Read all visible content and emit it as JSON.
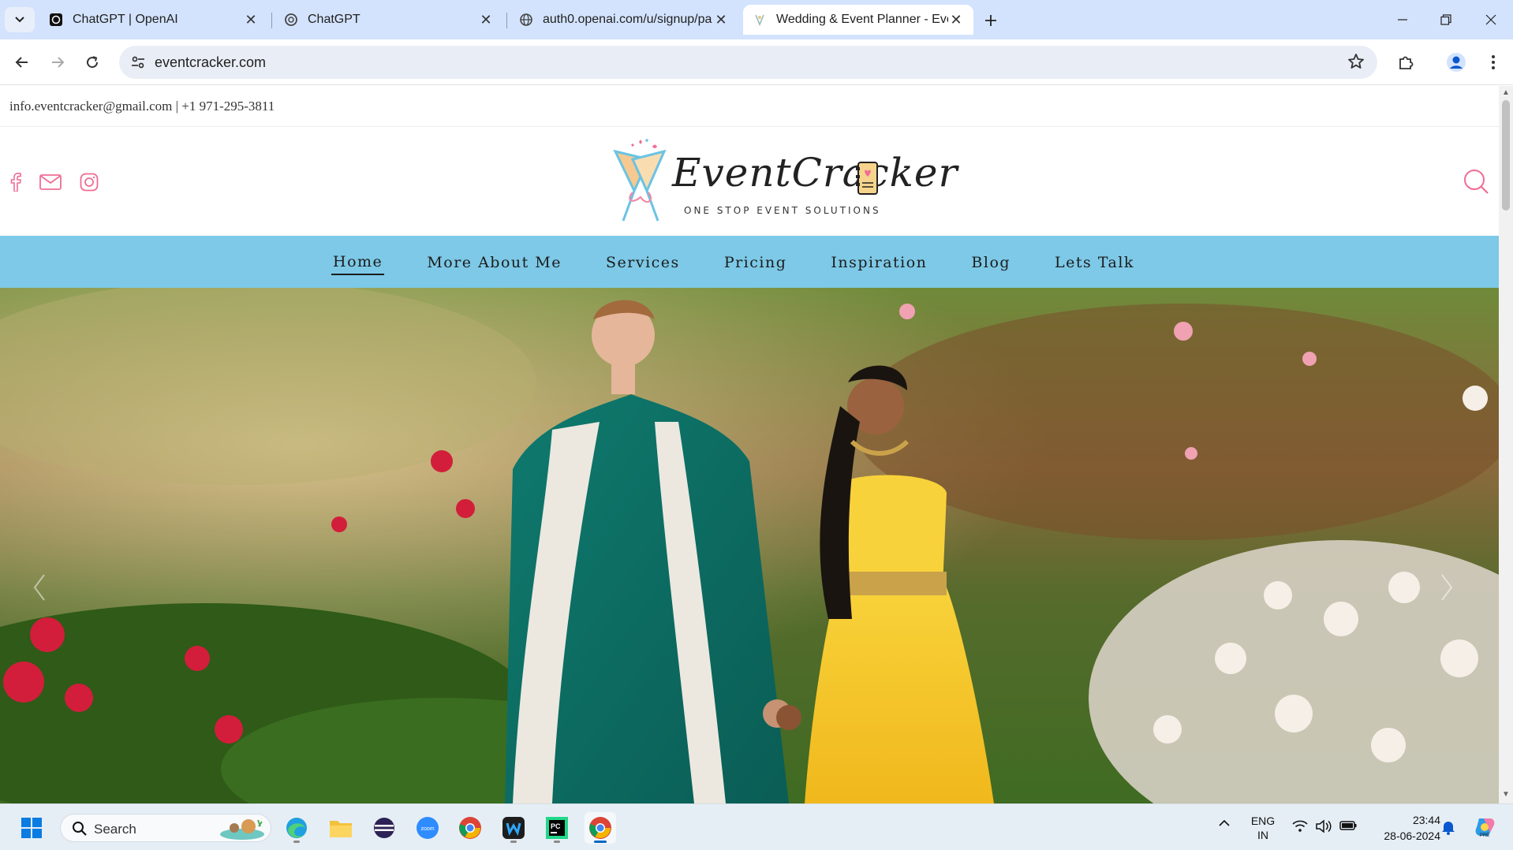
{
  "browser": {
    "tabs": [
      {
        "title": "ChatGPT | OpenAI",
        "icon": "openai-icon",
        "active": false
      },
      {
        "title": "ChatGPT",
        "icon": "openai-icon",
        "active": false
      },
      {
        "title": "auth0.openai.com/u/signup/pa",
        "icon": "globe-icon",
        "active": false
      },
      {
        "title": "Wedding & Event Planner - Eve",
        "icon": "eventcracker-favicon",
        "active": true
      }
    ],
    "address": "eventcracker.com"
  },
  "site": {
    "contact": "info.eventcracker@gmail.com | +1 971-295-3811",
    "logo": {
      "script": "EventCracker",
      "tagline": "ONE STOP EVENT SOLUTIONS"
    },
    "social": [
      "facebook-icon",
      "mail-icon",
      "instagram-icon"
    ],
    "nav": [
      {
        "label": "Home",
        "active": true
      },
      {
        "label": "More About Me",
        "active": false
      },
      {
        "label": "Services",
        "active": false
      },
      {
        "label": "Pricing",
        "active": false
      },
      {
        "label": "Inspiration",
        "active": false
      },
      {
        "label": "Blog",
        "active": false
      },
      {
        "label": "Lets Talk",
        "active": false
      }
    ],
    "colors": {
      "nav_bg": "#7dc9e7",
      "accent_pink": "#f06d95"
    }
  },
  "taskbar": {
    "search_label": "Search",
    "apps": [
      "windows-start-icon",
      "edge-icon",
      "file-explorer-icon",
      "eclipse-icon",
      "zoom-icon",
      "chrome-icon",
      "webstorm-icon",
      "pycharm-icon",
      "chrome-active-icon"
    ],
    "lang": {
      "line1": "ENG",
      "line2": "IN"
    },
    "time": "23:44",
    "date": "28-06-2024"
  }
}
